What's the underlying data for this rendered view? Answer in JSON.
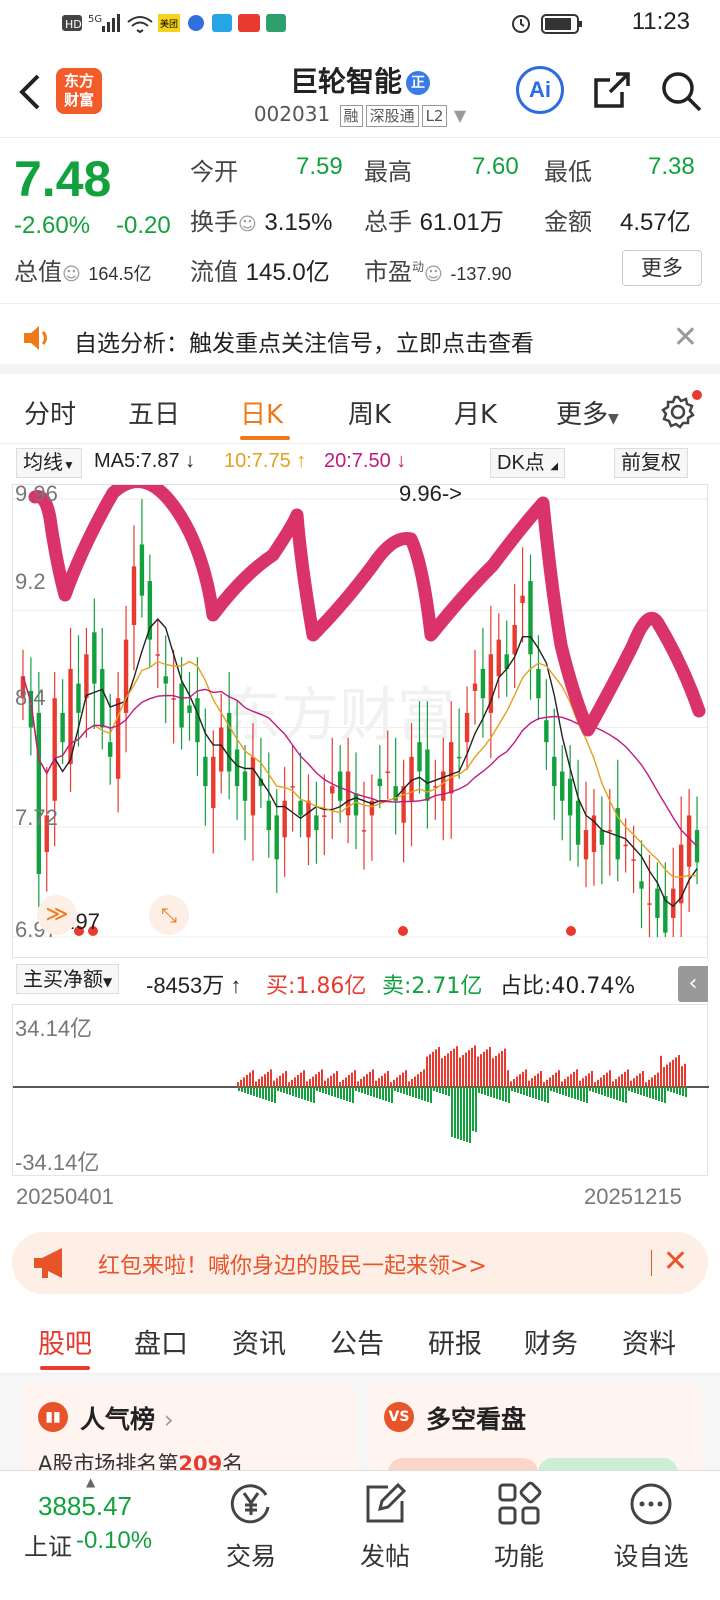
{
  "status_bar": {
    "time": "11:23",
    "network": "5G"
  },
  "header": {
    "logo_text_1": "东方",
    "logo_text_2": "财富",
    "stock_name": "巨轮智能",
    "stock_code": "002031",
    "tags": [
      "融",
      "深股通",
      "L2"
    ],
    "ai_label": "Ai"
  },
  "quote": {
    "price": "7.48",
    "change_pct": "-2.60%",
    "change_abs": "-0.20",
    "open_label": "今开",
    "open": "7.59",
    "high_label": "最高",
    "high": "7.60",
    "low_label": "最低",
    "low": "7.38",
    "turnover_label": "换手",
    "turnover": "3.15%",
    "volume_label": "总手",
    "volume": "61.01万",
    "amount_label": "金额",
    "amount": "4.57亿",
    "mcap_label": "总值",
    "mcap": "164.5亿",
    "float_label": "流值",
    "float": "145.0亿",
    "pe_label": "市盈",
    "pe_sup": "动",
    "pe": "-137.90",
    "more_label": "更多"
  },
  "banner": {
    "text": "自选分析：触发重点关注信号，立即点击查看"
  },
  "period_tabs": [
    "分时",
    "五日",
    "日K",
    "周K",
    "月K",
    "更多"
  ],
  "active_period": "日K",
  "ma_row": {
    "selector": "均线",
    "ma5": "MA5:7.87 ↓",
    "ma10": "10:7.75 ↑",
    "ma20": "20:7.50 ↓",
    "dk_label": "DK点",
    "adjust_label": "前复权"
  },
  "chart_data": {
    "type": "candlestick",
    "price_labels": [
      "9.96",
      "9.2",
      "8.4",
      "7.72",
      "6.97"
    ],
    "max_marker": "9.96->",
    "min_marker": "<-6.97",
    "x_start": "20250401",
    "x_end": "20251215",
    "series": [
      {
        "name": "MA5",
        "color": "#222222"
      },
      {
        "name": "MA10",
        "color": "#e6a020"
      },
      {
        "name": "MA20",
        "color": "#c0197f"
      }
    ],
    "close": [
      8.75,
      8.4,
      7.4,
      7.8,
      8.6,
      8.3,
      8.8,
      8.5,
      8.9,
      8.7,
      8.4,
      8.2,
      8.6,
      9.0,
      9.5,
      9.3,
      9.0,
      8.9,
      8.7,
      8.6,
      8.4,
      8.5,
      8.3,
      8.0,
      8.2,
      8.4,
      8.1,
      8.0,
      7.9,
      8.2,
      8.0,
      7.7,
      7.5,
      7.9,
      8.0,
      7.8,
      7.9,
      7.7,
      7.8,
      8.0,
      7.9,
      8.1,
      7.8,
      7.7,
      7.9,
      8.0,
      8.1,
      7.9,
      8.0,
      8.2,
      8.1,
      7.9,
      8.0,
      8.1,
      8.3,
      8.2,
      8.5,
      8.7,
      8.6,
      8.9,
      9.0,
      8.8,
      9.1,
      9.3,
      8.9,
      8.6,
      8.3,
      8.0,
      7.9,
      7.8,
      7.6,
      7.7,
      7.8,
      7.6,
      7.7,
      7.5,
      7.6,
      7.5,
      7.3,
      7.2,
      7.1,
      7.0,
      7.3,
      7.6,
      7.8,
      7.48
    ],
    "net_flow_range": [
      "34.14亿",
      "-34.14亿"
    ],
    "net_flow_label": "主买净额",
    "net_flow_value": "-8453万 ↑",
    "buy_label": "买:1.86亿",
    "sell_label": "卖:2.71亿",
    "ratio_label": "占比:40.74%"
  },
  "red_packet": {
    "text": "红包来啦！喊你身边的股民一起来领>>"
  },
  "content_tabs": [
    "股吧",
    "盘口",
    "资讯",
    "公告",
    "研报",
    "财务",
    "资料"
  ],
  "active_content_tab": "股吧",
  "cards": {
    "popularity_title": "人气榜",
    "popularity_sub_prefix": "A股市场排名第",
    "popularity_rank": "209",
    "popularity_sub_suffix": "名",
    "bullbear_title": "多空看盘"
  },
  "bottom_bar": {
    "index_value": "3885.47",
    "index_name": "上证",
    "index_change": "-0.10%",
    "nav": [
      "交易",
      "发帖",
      "功能",
      "设自选"
    ]
  },
  "colors": {
    "down": "#12a13c",
    "up": "#e83a2f",
    "accent": "#f07a1a",
    "annotation": "#d9336a"
  }
}
